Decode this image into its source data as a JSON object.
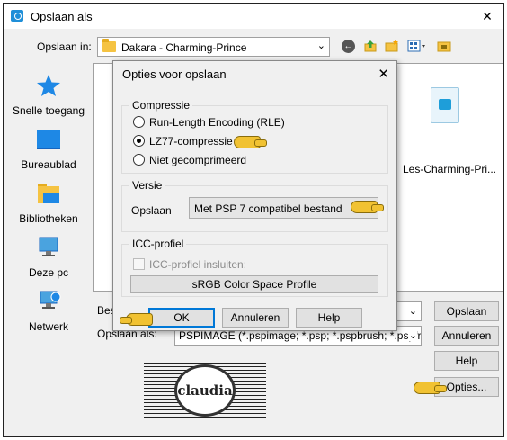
{
  "main_window": {
    "title": "Opslaan als",
    "close_label": "✕",
    "save_in_label": "Opslaan in:",
    "save_in_value": "Dakara - Charming-Prince",
    "places": [
      {
        "label": "Snelle toegang",
        "icon": "star-icon"
      },
      {
        "label": "Bureaublad",
        "icon": "desktop-icon"
      },
      {
        "label": "Bibliotheken",
        "icon": "library-icon"
      },
      {
        "label": "Deze pc",
        "icon": "computer-icon"
      },
      {
        "label": "Netwerk",
        "icon": "network-icon"
      }
    ],
    "file": {
      "name": "Les-Charming-Pri..."
    },
    "filename_label": "Bes",
    "filetype_label": "Opslaan als:",
    "filetype_value": "PSPIMAGE (*.pspimage; *.psp; *.pspbrush; *.pspframe;*",
    "buttons": {
      "save": "Opslaan",
      "cancel": "Annuleren",
      "help": "Help",
      "options": "Opties..."
    }
  },
  "options_dialog": {
    "title": "Opties voor opslaan",
    "close_label": "✕",
    "compression": {
      "label": "Compressie",
      "options": [
        {
          "label": "Run-Length Encoding (RLE)",
          "selected": false
        },
        {
          "label": "LZ77-compressie",
          "selected": true
        },
        {
          "label": "Niet gecomprimeerd",
          "selected": false
        }
      ]
    },
    "version": {
      "label": "Versie",
      "save_label": "Opslaan",
      "value": "Met PSP 7 compatibel bestand"
    },
    "icc": {
      "label": "ICC-profiel",
      "checkbox_label": "ICC-profiel insluiten:",
      "checked": false,
      "profile_button": "sRGB Color Space Profile"
    },
    "buttons": {
      "ok": "OK",
      "cancel": "Annuleren",
      "help": "Help"
    }
  },
  "watermark": {
    "text": "claudia"
  },
  "colors": {
    "accent": "#0078d7",
    "dialog_bg": "#f0f0f0",
    "pointer_hand": "#f1c232"
  }
}
